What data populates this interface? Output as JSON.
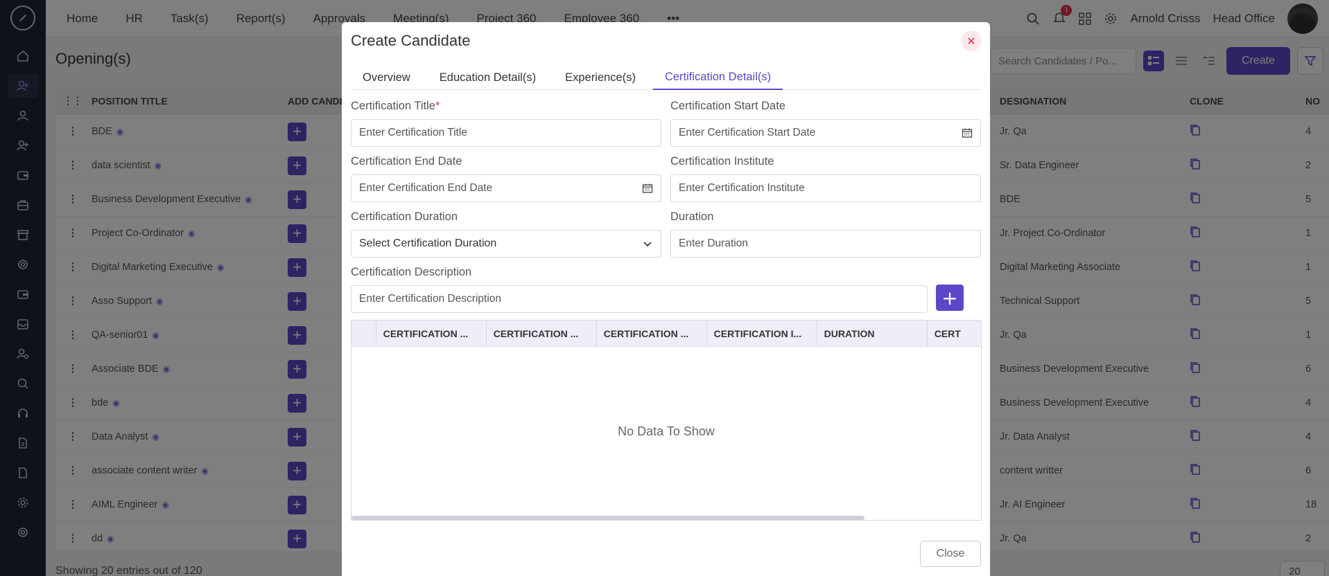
{
  "topnav": {
    "items": [
      "Home",
      "HR",
      "Task(s)",
      "Report(s)",
      "Approvals",
      "Meeting(s)",
      "Project 360",
      "Employee 360"
    ],
    "notification_count": "1",
    "user_name": "Arnold Crisss",
    "office": "Head Office"
  },
  "page": {
    "title": "Opening(s)",
    "search_placeholder": "Search Candidates / Po...",
    "create_label": "Create",
    "columns": {
      "position_title": "POSITION TITLE",
      "add_candidate": "ADD CANDI",
      "designation": "DESIGNATION",
      "clone": "CLONE",
      "no": "NO"
    },
    "rows": [
      {
        "position": "BDE",
        "designation": "Jr. Qa",
        "no": "4"
      },
      {
        "position": "data scientist",
        "designation": "Sr. Data Engineer",
        "no": "2"
      },
      {
        "position": "Business Development Executive",
        "designation": "BDE",
        "no": "5"
      },
      {
        "position": "Project Co-Ordinator",
        "designation": "Jr. Project Co-Ordinator",
        "no": "1"
      },
      {
        "position": "Digital Marketing Executive",
        "designation": "Digital Marketing Associate",
        "no": "1"
      },
      {
        "position": "Asso Support",
        "designation": "Technical Support",
        "no": "5"
      },
      {
        "position": "QA-senior01",
        "designation": "Jr. Qa",
        "no": "1"
      },
      {
        "position": "Associate BDE",
        "designation": "Business Development Executive",
        "no": "6"
      },
      {
        "position": "bde",
        "designation": "Business Development Executive",
        "no": "4"
      },
      {
        "position": "Data Analyst",
        "designation": "Jr. Data Analyst",
        "no": "4"
      },
      {
        "position": "associate content writer",
        "designation": "content writter",
        "no": "6"
      },
      {
        "position": "AIML Engineer",
        "designation": "Jr. AI Engineer",
        "no": "18"
      },
      {
        "position": "dd",
        "designation": "Jr. Qa",
        "no": "2"
      }
    ],
    "footer_text": "Showing 20 entries out of 120",
    "page_size": "20"
  },
  "modal": {
    "title": "Create Candidate",
    "tabs": [
      "Overview",
      "Education Detail(s)",
      "Experience(s)",
      "Certification Detail(s)"
    ],
    "active_tab": "Certification Detail(s)",
    "fields": {
      "cert_title_label": "Certification Title",
      "cert_title_placeholder": "Enter Certification Title",
      "cert_start_label": "Certification Start Date",
      "cert_start_placeholder": "Enter Certification Start Date",
      "cert_end_label": "Certification End Date",
      "cert_end_placeholder": "Enter Certification End Date",
      "cert_institute_label": "Certification Institute",
      "cert_institute_placeholder": "Enter Certification Institute",
      "cert_duration_label": "Certification Duration",
      "cert_duration_placeholder": "Select Certification Duration",
      "duration_label": "Duration",
      "duration_placeholder": "Enter Duration",
      "cert_desc_label": "Certification Description",
      "cert_desc_placeholder": "Enter Certification Description"
    },
    "grid": {
      "headers": [
        "CERTIFICATION ...",
        "CERTIFICATION ...",
        "CERTIFICATION ...",
        "CERTIFICATION I...",
        "DURATION",
        "CERT"
      ],
      "empty_text": "No Data To Show"
    },
    "close_label": "Close"
  },
  "accent_color": "#5a48c9"
}
